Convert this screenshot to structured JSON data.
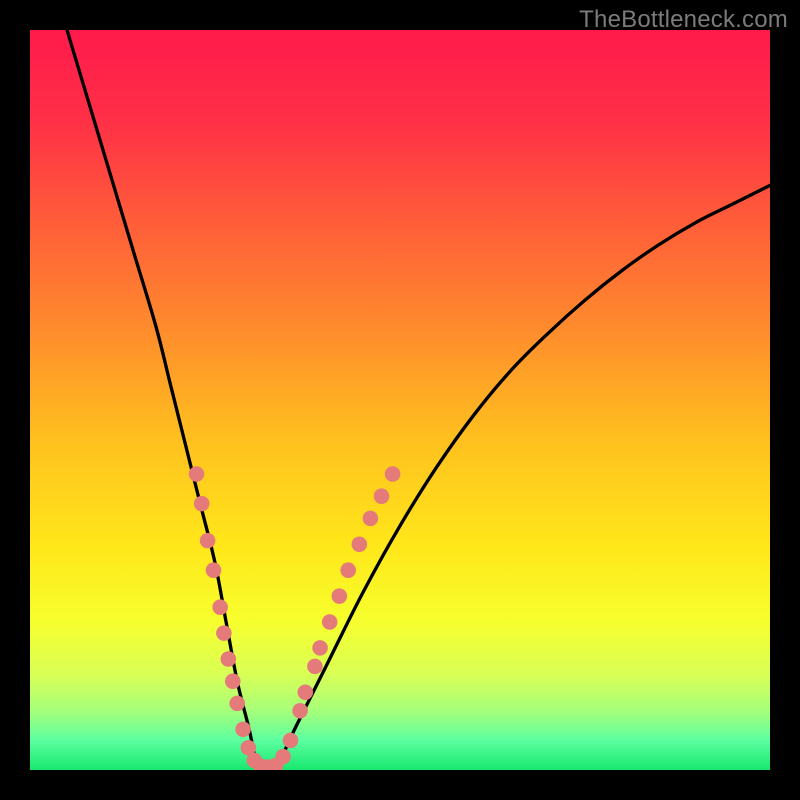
{
  "watermark": "TheBottleneck.com",
  "chart_data": {
    "type": "line",
    "title": "",
    "xlabel": "",
    "ylabel": "",
    "xlim": [
      0,
      100
    ],
    "ylim": [
      0,
      100
    ],
    "series": [
      {
        "name": "bottleneck-curve",
        "x": [
          5,
          8,
          11,
          14,
          17,
          19,
          21,
          23,
          25,
          26.5,
          28,
          29.5,
          31,
          33,
          36,
          40,
          45,
          50,
          55,
          60,
          65,
          70,
          75,
          80,
          85,
          90,
          95,
          100
        ],
        "values": [
          100,
          90,
          80,
          70,
          60,
          52,
          44,
          36,
          28,
          20,
          12,
          6,
          0,
          0,
          6,
          14,
          24,
          33,
          41,
          48,
          54,
          59,
          63.5,
          67.5,
          71,
          74,
          76.5,
          79
        ]
      }
    ],
    "markers": {
      "name": "highlight-dots",
      "color": "#e47a7a",
      "points": [
        {
          "x": 22.5,
          "y": 40
        },
        {
          "x": 23.2,
          "y": 36
        },
        {
          "x": 24.0,
          "y": 31
        },
        {
          "x": 24.8,
          "y": 27
        },
        {
          "x": 25.7,
          "y": 22
        },
        {
          "x": 26.2,
          "y": 18.5
        },
        {
          "x": 26.8,
          "y": 15
        },
        {
          "x": 27.4,
          "y": 12
        },
        {
          "x": 28.0,
          "y": 9
        },
        {
          "x": 28.8,
          "y": 5.5
        },
        {
          "x": 29.5,
          "y": 3
        },
        {
          "x": 30.3,
          "y": 1.3
        },
        {
          "x": 31.2,
          "y": 0.5
        },
        {
          "x": 32.2,
          "y": 0.4
        },
        {
          "x": 33.2,
          "y": 0.6
        },
        {
          "x": 34.2,
          "y": 1.8
        },
        {
          "x": 35.2,
          "y": 4
        },
        {
          "x": 36.5,
          "y": 8
        },
        {
          "x": 37.2,
          "y": 10.5
        },
        {
          "x": 38.5,
          "y": 14
        },
        {
          "x": 39.2,
          "y": 16.5
        },
        {
          "x": 40.5,
          "y": 20
        },
        {
          "x": 41.8,
          "y": 23.5
        },
        {
          "x": 43.0,
          "y": 27
        },
        {
          "x": 44.5,
          "y": 30.5
        },
        {
          "x": 46.0,
          "y": 34
        },
        {
          "x": 47.5,
          "y": 37
        },
        {
          "x": 49.0,
          "y": 40
        }
      ]
    },
    "gradient_stops": [
      {
        "offset": 0.0,
        "color": "#ff1a4b"
      },
      {
        "offset": 0.12,
        "color": "#ff2f47"
      },
      {
        "offset": 0.25,
        "color": "#ff5a3a"
      },
      {
        "offset": 0.4,
        "color": "#ff8a2d"
      },
      {
        "offset": 0.55,
        "color": "#ffbf1f"
      },
      {
        "offset": 0.7,
        "color": "#ffe81a"
      },
      {
        "offset": 0.8,
        "color": "#f7ff2e"
      },
      {
        "offset": 0.87,
        "color": "#d9ff55"
      },
      {
        "offset": 0.92,
        "color": "#a6ff7a"
      },
      {
        "offset": 0.96,
        "color": "#5cffa0"
      },
      {
        "offset": 1.0,
        "color": "#17e86f"
      }
    ]
  }
}
